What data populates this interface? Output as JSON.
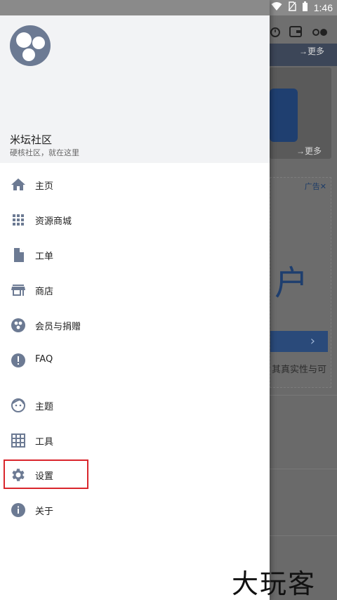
{
  "status_bar": {
    "time": "1:46"
  },
  "drawer": {
    "header": {
      "title": "米坛社区",
      "subtitle": "硬核社区，就在这里"
    },
    "menu": [
      {
        "id": "home",
        "label": "主页",
        "icon": "home-icon"
      },
      {
        "id": "resources",
        "label": "资源商城",
        "icon": "grid-icon"
      },
      {
        "id": "ticket",
        "label": "工单",
        "icon": "document-icon"
      },
      {
        "id": "shop",
        "label": "商店",
        "icon": "store-icon"
      },
      {
        "id": "membership",
        "label": "会员与捐赠",
        "icon": "membership-icon"
      },
      {
        "id": "faq",
        "label": "FAQ",
        "icon": "alert-icon"
      },
      {
        "id": "theme",
        "label": "主题",
        "icon": "face-icon"
      },
      {
        "id": "tools",
        "label": "工具",
        "icon": "table-icon"
      },
      {
        "id": "settings",
        "label": "设置",
        "icon": "gear-icon"
      },
      {
        "id": "about",
        "label": "关于",
        "icon": "info-icon"
      }
    ]
  },
  "background": {
    "more_label_1": "→更多",
    "more_label_2": "→更多",
    "ad_label": "广告✕",
    "ad_big_char": "户",
    "ad_text": "其真实性与可"
  },
  "watermark": "大玩客",
  "colors": {
    "icon": "#6c7a93",
    "highlight": "#d9262c",
    "ad_blue": "#1f3f70"
  }
}
